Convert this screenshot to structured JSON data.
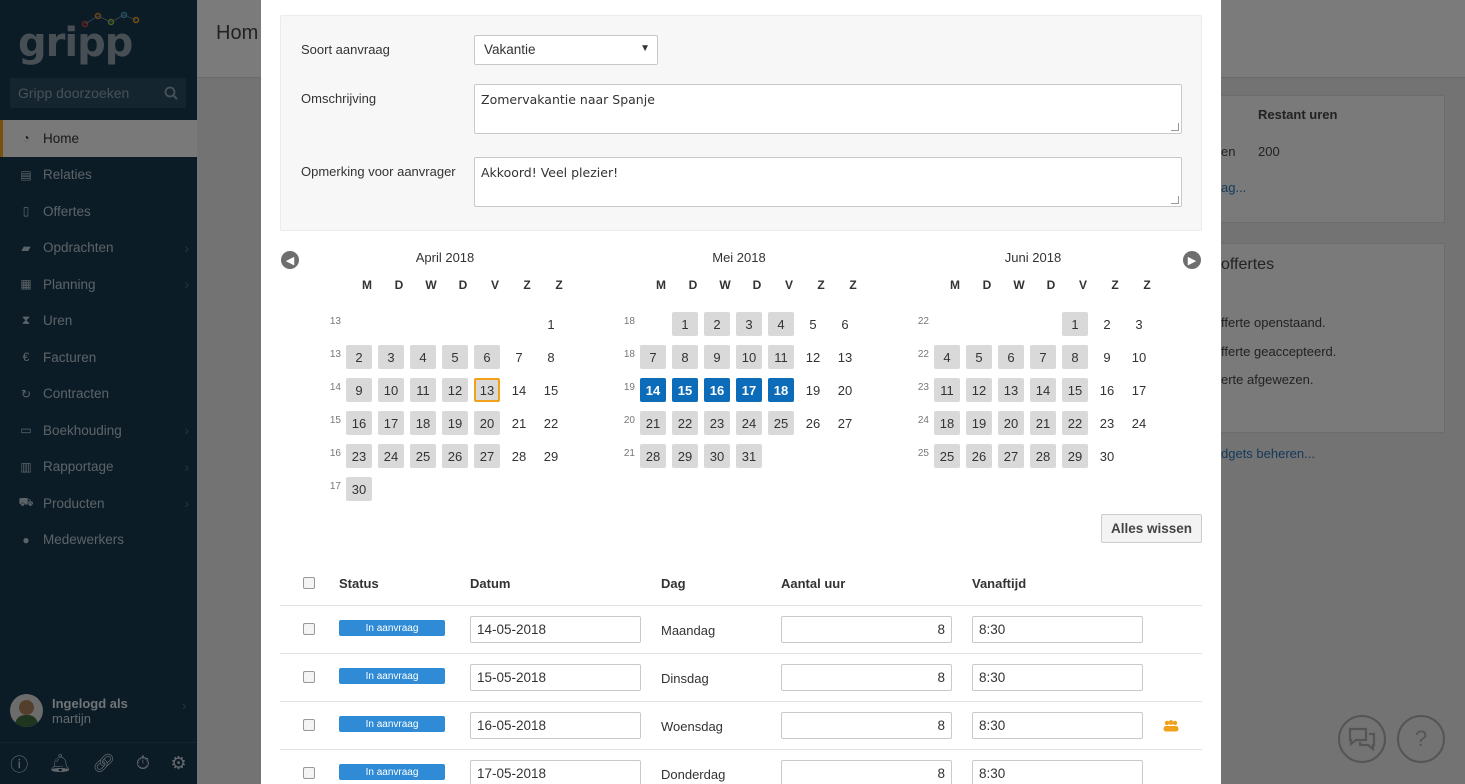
{
  "sidebar": {
    "logo": "gripp",
    "search_placeholder": "Gripp doorzoeken",
    "items": [
      {
        "label": "Home",
        "icon": "dashboard-icon"
      },
      {
        "label": "Relaties",
        "icon": "building-icon"
      },
      {
        "label": "Offertes",
        "icon": "document-icon"
      },
      {
        "label": "Opdrachten",
        "icon": "folder-icon"
      },
      {
        "label": "Planning",
        "icon": "calendar-icon"
      },
      {
        "label": "Uren",
        "icon": "hourglass-icon"
      },
      {
        "label": "Facturen",
        "icon": "euro-icon"
      },
      {
        "label": "Contracten",
        "icon": "refresh-icon"
      },
      {
        "label": "Boekhouding",
        "icon": "keyboard-icon"
      },
      {
        "label": "Rapportage",
        "icon": "bar-chart-icon"
      },
      {
        "label": "Producten",
        "icon": "cart-icon"
      },
      {
        "label": "Medewerkers",
        "icon": "users-icon"
      }
    ],
    "user_line1": "Ingelogd als",
    "user_line2": "martijn"
  },
  "background": {
    "title": "Hom",
    "col_header": "Restant uren",
    "row_partial": "en",
    "row_value": "200",
    "link1": "ag...",
    "panel_title": "offertes",
    "lines": [
      "fferte openstaand.",
      "fferte geaccepteerd.",
      "erte afgewezen."
    ],
    "link2": "dgets beheren..."
  },
  "form": {
    "type_label": "Soort aanvraag",
    "type_value": "Vakantie",
    "desc_label": "Omschrijving",
    "desc_value": "Zomervakantie naar Spanje",
    "note_label": "Opmerking voor aanvrager",
    "note_value": "Akkoord! Veel plezier!"
  },
  "calendar": {
    "dow": [
      "M",
      "D",
      "W",
      "D",
      "V",
      "Z",
      "Z"
    ],
    "months": [
      {
        "title": "April 2018",
        "weeks": [
          {
            "wk": "13",
            "days": [
              "",
              "",
              "",
              "",
              "",
              "",
              "1"
            ]
          },
          {
            "wk": "13",
            "days": [
              "2",
              "3",
              "4",
              "5",
              "6",
              "7",
              "8"
            ]
          },
          {
            "wk": "14",
            "days": [
              "9",
              "10",
              "11",
              "12",
              "13",
              "14",
              "15"
            ]
          },
          {
            "wk": "15",
            "days": [
              "16",
              "17",
              "18",
              "19",
              "20",
              "21",
              "22"
            ]
          },
          {
            "wk": "16",
            "days": [
              "23",
              "24",
              "25",
              "26",
              "27",
              "28",
              "29"
            ]
          },
          {
            "wk": "17",
            "days": [
              "30",
              "",
              "",
              "",
              "",
              "",
              ""
            ]
          }
        ],
        "today": "13",
        "selected": []
      },
      {
        "title": "Mei 2018",
        "weeks": [
          {
            "wk": "18",
            "days": [
              "",
              "1",
              "2",
              "3",
              "4",
              "5",
              "6"
            ]
          },
          {
            "wk": "18",
            "days": [
              "7",
              "8",
              "9",
              "10",
              "11",
              "12",
              "13"
            ]
          },
          {
            "wk": "19",
            "days": [
              "14",
              "15",
              "16",
              "17",
              "18",
              "19",
              "20"
            ]
          },
          {
            "wk": "20",
            "days": [
              "21",
              "22",
              "23",
              "24",
              "25",
              "26",
              "27"
            ]
          },
          {
            "wk": "21",
            "days": [
              "28",
              "29",
              "30",
              "31",
              "",
              "",
              ""
            ]
          }
        ],
        "today": "",
        "selected": [
          "14",
          "15",
          "16",
          "17",
          "18"
        ]
      },
      {
        "title": "Juni 2018",
        "weeks": [
          {
            "wk": "22",
            "days": [
              "",
              "",
              "",
              "",
              "1",
              "2",
              "3"
            ]
          },
          {
            "wk": "22",
            "days": [
              "4",
              "5",
              "6",
              "7",
              "8",
              "9",
              "10"
            ]
          },
          {
            "wk": "23",
            "days": [
              "11",
              "12",
              "13",
              "14",
              "15",
              "16",
              "17"
            ]
          },
          {
            "wk": "24",
            "days": [
              "18",
              "19",
              "20",
              "21",
              "22",
              "23",
              "24"
            ]
          },
          {
            "wk": "25",
            "days": [
              "25",
              "26",
              "27",
              "28",
              "29",
              "30",
              ""
            ]
          }
        ],
        "today": "",
        "selected": []
      }
    ],
    "clear_label": "Alles wissen"
  },
  "table": {
    "headers": {
      "status": "Status",
      "date": "Datum",
      "day": "Dag",
      "hours": "Aantal uur",
      "from": "Vanaftijd"
    },
    "rows": [
      {
        "status": "In aanvraag",
        "date": "14-05-2018",
        "day": "Maandag",
        "hours": "8",
        "from": "8:30",
        "group_icon": false
      },
      {
        "status": "In aanvraag",
        "date": "15-05-2018",
        "day": "Dinsdag",
        "hours": "8",
        "from": "8:30",
        "group_icon": false
      },
      {
        "status": "In aanvraag",
        "date": "16-05-2018",
        "day": "Woensdag",
        "hours": "8",
        "from": "8:30",
        "group_icon": true
      },
      {
        "status": "In aanvraag",
        "date": "17-05-2018",
        "day": "Donderdag",
        "hours": "8",
        "from": "8:30",
        "group_icon": false
      }
    ]
  },
  "colors": {
    "accent": "#f0a31a",
    "selected": "#0c6cb9",
    "badge": "#2f8bd6",
    "sidebar": "#16384f"
  }
}
